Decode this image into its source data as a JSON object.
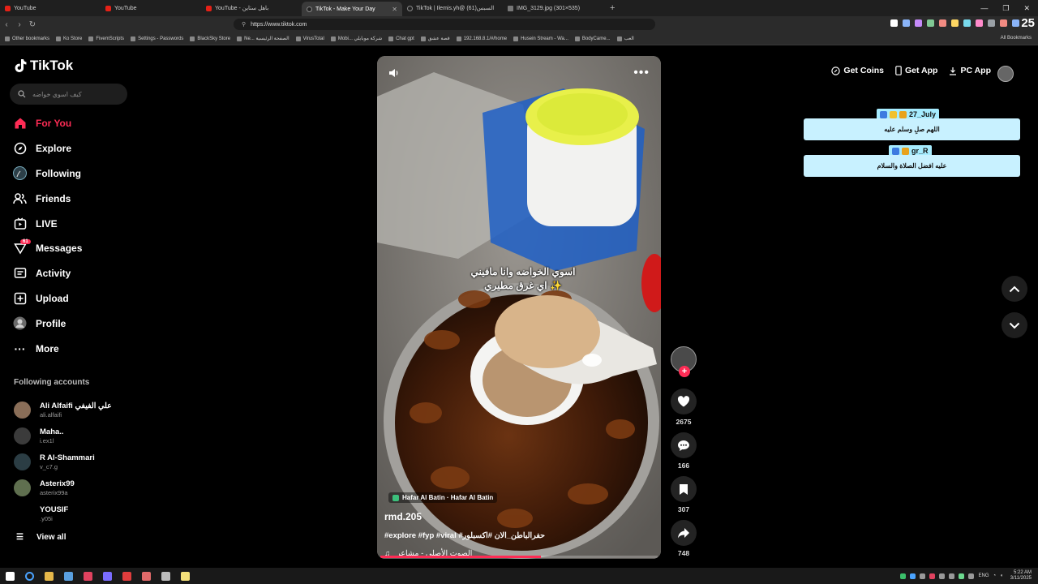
{
  "browser": {
    "tabs": [
      {
        "label": "YouTube",
        "favicon": "youtube-icon",
        "active": false
      },
      {
        "label": "YouTube",
        "favicon": "youtube-icon",
        "active": false
      },
      {
        "label": "YouTube - باهل ستاين",
        "favicon": "youtube-icon",
        "active": false
      },
      {
        "label": "TikTok - Make Your Day",
        "favicon": "tiktok-icon",
        "active": true
      },
      {
        "label": "TikTok | Ilemis.yh@ (61)السبس",
        "favicon": "tiktok-icon",
        "active": false
      },
      {
        "label": "IMG_3129.jpg (301×535)",
        "favicon": "image-icon",
        "active": false
      }
    ],
    "url": "https://www.tiktok.com",
    "bookmarks": [
      "Other bookmarks",
      "Ko Store",
      "FivemScripts",
      "Settings - Passwords",
      "BlackSky Store",
      "Ne... الصفحة الرئيسية",
      "VirusTotal",
      "Mobi... شركة موبايلي",
      "Chat gpt",
      "قصة عشق",
      "192.168.8.1/#/home",
      "Husein Stream - Wa...",
      "BodyCame...",
      "العب"
    ],
    "all_bookmarks": "All Bookmarks",
    "extension_colors": [
      "#ffffff",
      "#8ab4f8",
      "#c58af9",
      "#81c995",
      "#f28b82",
      "#fdd663",
      "#78d9ec",
      "#ff8bcb",
      "#9aa0a6",
      "#f28b82",
      "#8ab4f8",
      "#fdd663"
    ]
  },
  "sidebar": {
    "logo": "TikTok",
    "search_placeholder": "كيف اسوي خواضه",
    "nav": [
      {
        "label": "For You",
        "icon": "home-icon",
        "active": true
      },
      {
        "label": "Explore",
        "icon": "compass-icon"
      },
      {
        "label": "Following",
        "icon": "following-avatar-icon"
      },
      {
        "label": "Friends",
        "icon": "friends-icon"
      },
      {
        "label": "LIVE",
        "icon": "live-icon"
      },
      {
        "label": "Messages",
        "icon": "messages-icon",
        "badge": "61"
      },
      {
        "label": "Activity",
        "icon": "activity-icon"
      },
      {
        "label": "Upload",
        "icon": "upload-icon"
      },
      {
        "label": "Profile",
        "icon": "profile-avatar-icon"
      },
      {
        "label": "More",
        "icon": "more-icon"
      }
    ],
    "following_title": "Following accounts",
    "accounts": [
      {
        "name": "Ali Alfaifi علي الفيفي",
        "username": "ali.alfaifi",
        "color": "#8a6e58"
      },
      {
        "name": "Maha..",
        "username": "i.ex1l",
        "color": "#3b3b3b"
      },
      {
        "name": "R Al-Shammari",
        "username": "v_c7.g",
        "color": "#2b3d44"
      },
      {
        "name": "Asterix99",
        "username": "asterix99a",
        "color": "#5f6f4f"
      },
      {
        "name": "YOUSIF",
        "username": ".y05i",
        "color": "#000000"
      }
    ],
    "view_all": "View all"
  },
  "video": {
    "caption_line1": "اسوي الخواضه وانا مافيني",
    "caption_line2": "اي غرق مطيري ✨",
    "location": "Hafar Al Batin · Hafar Al Batin",
    "author": "rmd.205",
    "hashtags": "#explore #fyp #viral #حفرالباطن_الان #اكسبلور",
    "sound": "الصوت الأصلي - مشاعر",
    "progress": 0.58
  },
  "actions": {
    "likes": "2675",
    "comments": "166",
    "saves": "307",
    "shares": "748"
  },
  "topbar": {
    "get_coins": "Get Coins",
    "get_app": "Get App",
    "pc_app": "PC App"
  },
  "overlay_chat": [
    {
      "name": "27_July",
      "message": "اللهم صلِ وسلم عليه"
    },
    {
      "name": "gr_R",
      "message": "عليه افضل الصلاة والسلام"
    }
  ],
  "taskbar": {
    "time": "5:22 AM",
    "date": "3/11/2025",
    "lang": "ENG",
    "corner_number": "25",
    "app_colors": [
      "#ffffff",
      "#4aa3ff",
      "#e6b84a",
      "#5aa0e0",
      "#e0425f",
      "#7a6cff",
      "#e03d3d",
      "#e06a6a",
      "#bbbbbb",
      "#f4e07a"
    ]
  }
}
